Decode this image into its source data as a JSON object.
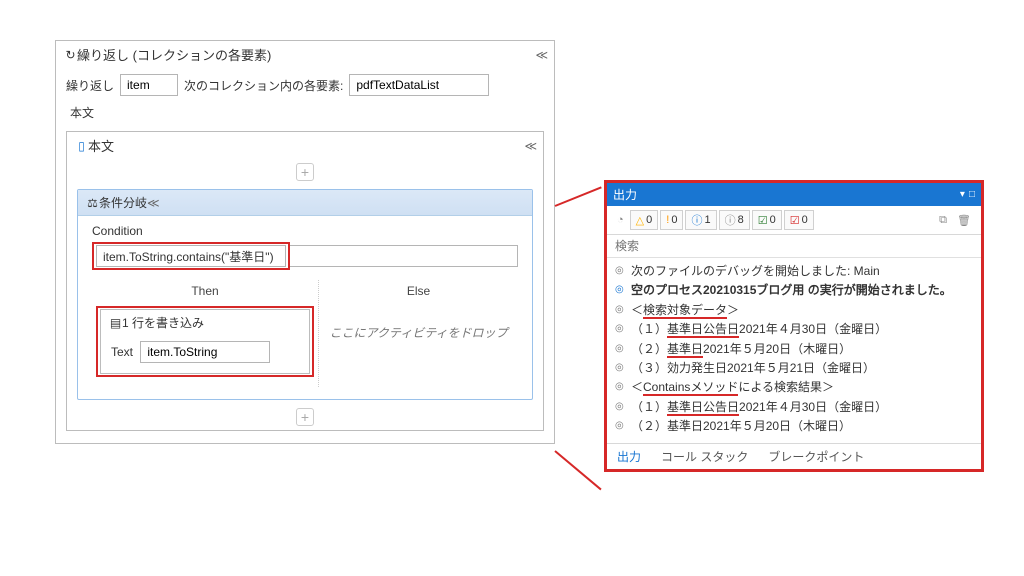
{
  "foreach": {
    "title": "繰り返し (コレクションの各要素)",
    "loop_label": "繰り返し",
    "item_value": "item",
    "mid_label": "次のコレクション内の各要素:",
    "collection_value": "pdfTextDataList",
    "body_label": "本文",
    "inner_title": "本文"
  },
  "if_block": {
    "title": "条件分岐",
    "condition_label": "Condition",
    "condition_value": "item.ToString.contains(\"基準日\")",
    "then_label": "Then",
    "else_label": "Else",
    "else_placeholder": "ここにアクティビティをドロップ"
  },
  "writeline": {
    "title": "1 行を書き込み",
    "text_label": "Text",
    "text_value": "item.ToString"
  },
  "output": {
    "title": "出力",
    "counts": {
      "warning": "0",
      "orange": "0",
      "info_blue": "1",
      "info_grey": "8",
      "ok": "0",
      "fail": "0"
    },
    "search_placeholder": "検索",
    "tabs": {
      "output": "出力",
      "callstack": "コール スタック",
      "breakpoints": "ブレークポイント"
    },
    "log": [
      "次のファイルのデバッグを開始しました: Main",
      "空のプロセス20210315ブログ用 の実行が開始されました。",
      "＜検索対象データ＞",
      "（１）基準日公告日2021年４月30日（金曜日）",
      "（２）基準日2021年５月20日（木曜日）",
      "（３）効力発生日2021年５月21日（金曜日）",
      "＜Containsメソッドによる検索結果＞",
      "（１）基準日公告日2021年４月30日（金曜日）",
      "（２）基準日2021年５月20日（木曜日）"
    ]
  }
}
